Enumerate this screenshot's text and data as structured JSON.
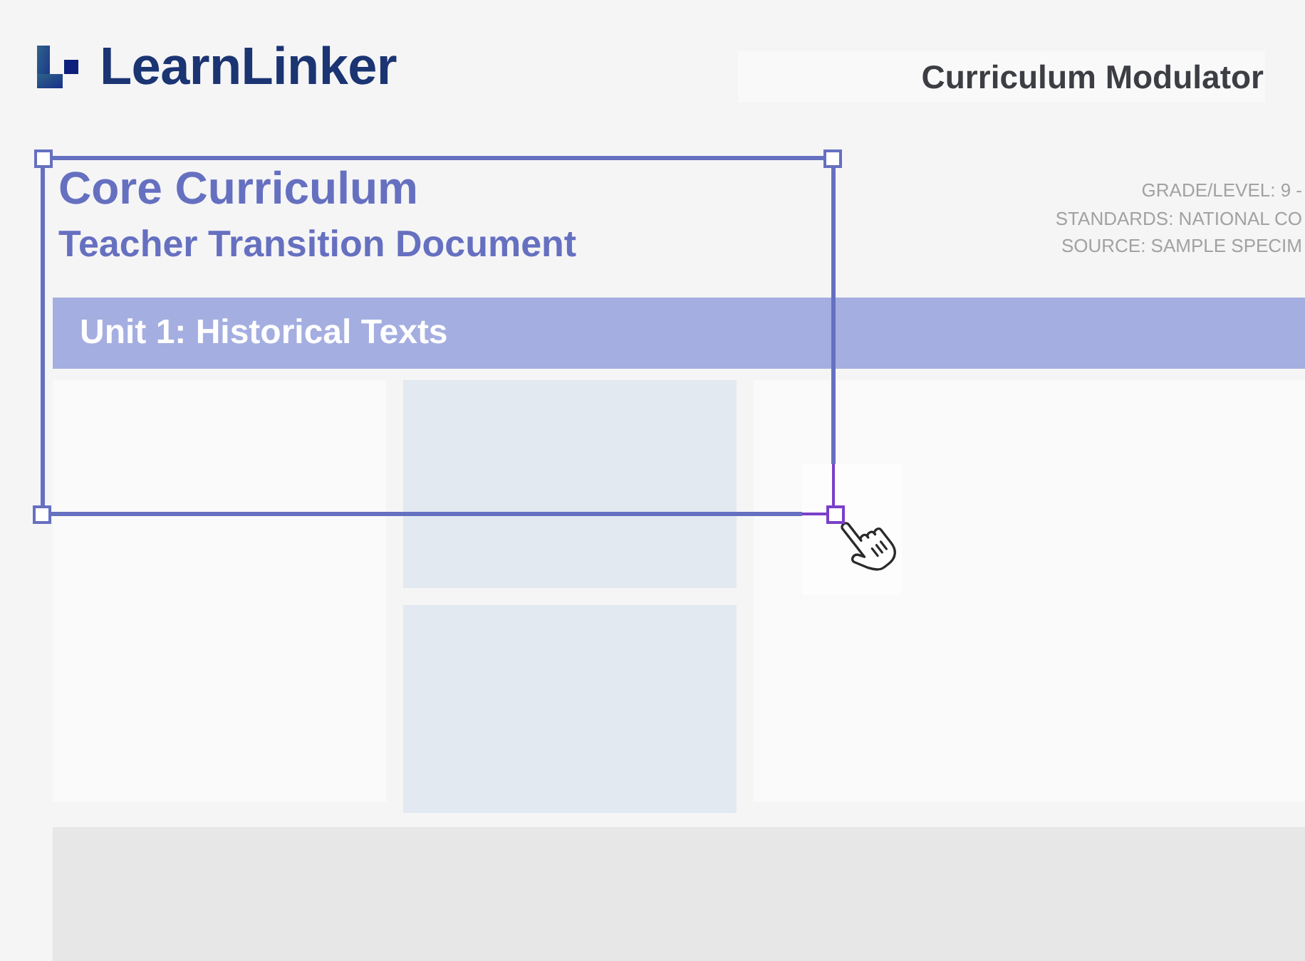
{
  "brand": {
    "name": "LearnLinker"
  },
  "header": {
    "title": "Curriculum Modulator"
  },
  "document": {
    "title": "Core Curriculum",
    "subtitle": "Teacher Transition Document",
    "meta": [
      "GRADE/LEVEL: 9 -",
      "STANDARDS: NATIONAL CO",
      "SOURCE: SAMPLE SPECIM"
    ]
  },
  "unit": {
    "title": "Unit 1: Historical Texts"
  }
}
